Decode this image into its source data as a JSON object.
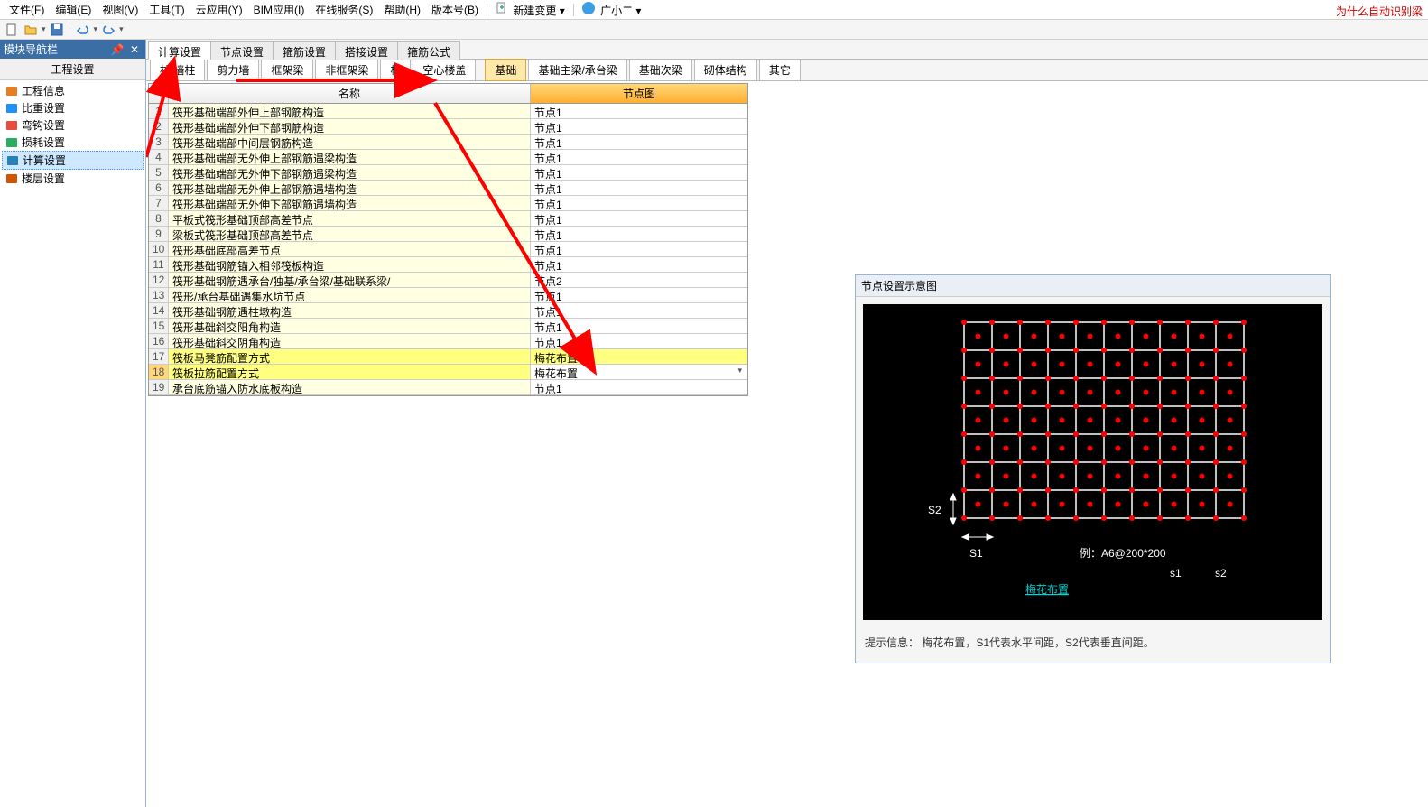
{
  "menubar": {
    "items": [
      "文件(F)",
      "编辑(E)",
      "视图(V)",
      "工具(T)",
      "云应用(Y)",
      "BIM应用(I)",
      "在线服务(S)",
      "帮助(H)",
      "版本号(B)"
    ],
    "new_change": "新建变更",
    "user": "广小二"
  },
  "right_note": "为什么自动识别梁",
  "nav": {
    "title": "模块导航栏",
    "subtitle": "工程设置",
    "items": [
      {
        "icon": "#e67e22",
        "label": "工程信息"
      },
      {
        "icon": "#1e90ff",
        "label": "比重设置"
      },
      {
        "icon": "#e74c3c",
        "label": "弯钩设置"
      },
      {
        "icon": "#27ae60",
        "label": "损耗设置"
      },
      {
        "icon": "#2980b9",
        "label": "计算设置",
        "selected": true
      },
      {
        "icon": "#d35400",
        "label": "楼层设置"
      }
    ]
  },
  "tabs1": [
    "计算设置",
    "节点设置",
    "箍筋设置",
    "搭接设置",
    "箍筋公式"
  ],
  "tabs2": [
    "柱/墙柱",
    "剪力墙",
    "框架梁",
    "非框架梁",
    "板",
    "空心楼盖",
    "基础",
    "基础主梁/承台梁",
    "基础次梁",
    "砌体结构",
    "其它"
  ],
  "tabs2_active": 6,
  "table": {
    "headers": {
      "num": "",
      "name": "名称",
      "node": "节点图"
    },
    "rows": [
      {
        "n": 1,
        "name": "筏形基础端部外伸上部钢筋构造",
        "node": "节点1"
      },
      {
        "n": 2,
        "name": "筏形基础端部外伸下部钢筋构造",
        "node": "节点1"
      },
      {
        "n": 3,
        "name": "筏形基础端部中间层钢筋构造",
        "node": "节点1"
      },
      {
        "n": 4,
        "name": "筏形基础端部无外伸上部钢筋遇梁构造",
        "node": "节点1"
      },
      {
        "n": 5,
        "name": "筏形基础端部无外伸下部钢筋遇梁构造",
        "node": "节点1"
      },
      {
        "n": 6,
        "name": "筏形基础端部无外伸上部钢筋遇墙构造",
        "node": "节点1"
      },
      {
        "n": 7,
        "name": "筏形基础端部无外伸下部钢筋遇墙构造",
        "node": "节点1"
      },
      {
        "n": 8,
        "name": "平板式筏形基础顶部高差节点",
        "node": "节点1"
      },
      {
        "n": 9,
        "name": "梁板式筏形基础顶部高差节点",
        "node": "节点1"
      },
      {
        "n": 10,
        "name": "筏形基础底部高差节点",
        "node": "节点1"
      },
      {
        "n": 11,
        "name": "筏形基础钢筋锚入相邻筏板构造",
        "node": "节点1"
      },
      {
        "n": 12,
        "name": "筏形基础钢筋遇承台/独基/承台梁/基础联系梁/",
        "node": "节点2"
      },
      {
        "n": 13,
        "name": "筏形/承台基础遇集水坑节点",
        "node": "节点1"
      },
      {
        "n": 14,
        "name": "筏形基础钢筋遇柱墩构造",
        "node": "节点1"
      },
      {
        "n": 15,
        "name": "筏形基础斜交阳角构造",
        "node": "节点1"
      },
      {
        "n": 16,
        "name": "筏形基础斜交阴角构造",
        "node": "节点1"
      },
      {
        "n": 17,
        "name": "筏板马凳筋配置方式",
        "node": "梅花布置",
        "hl": true
      },
      {
        "n": 18,
        "name": "筏板拉筋配置方式",
        "node": "梅花布置",
        "hl": true,
        "sel": true,
        "dd": true
      },
      {
        "n": 19,
        "name": "承台底筋锚入防水底板构造",
        "node": "节点1"
      }
    ]
  },
  "diagram": {
    "title": "节点设置示意图",
    "s1": "S1",
    "s2": "S2",
    "example": "例：A6@200*200",
    "s1_label": "s1",
    "s2_label": "s2",
    "name": "梅花布置",
    "hint": "提示信息：  梅花布置，S1代表水平间距，S2代表垂直间距。"
  }
}
